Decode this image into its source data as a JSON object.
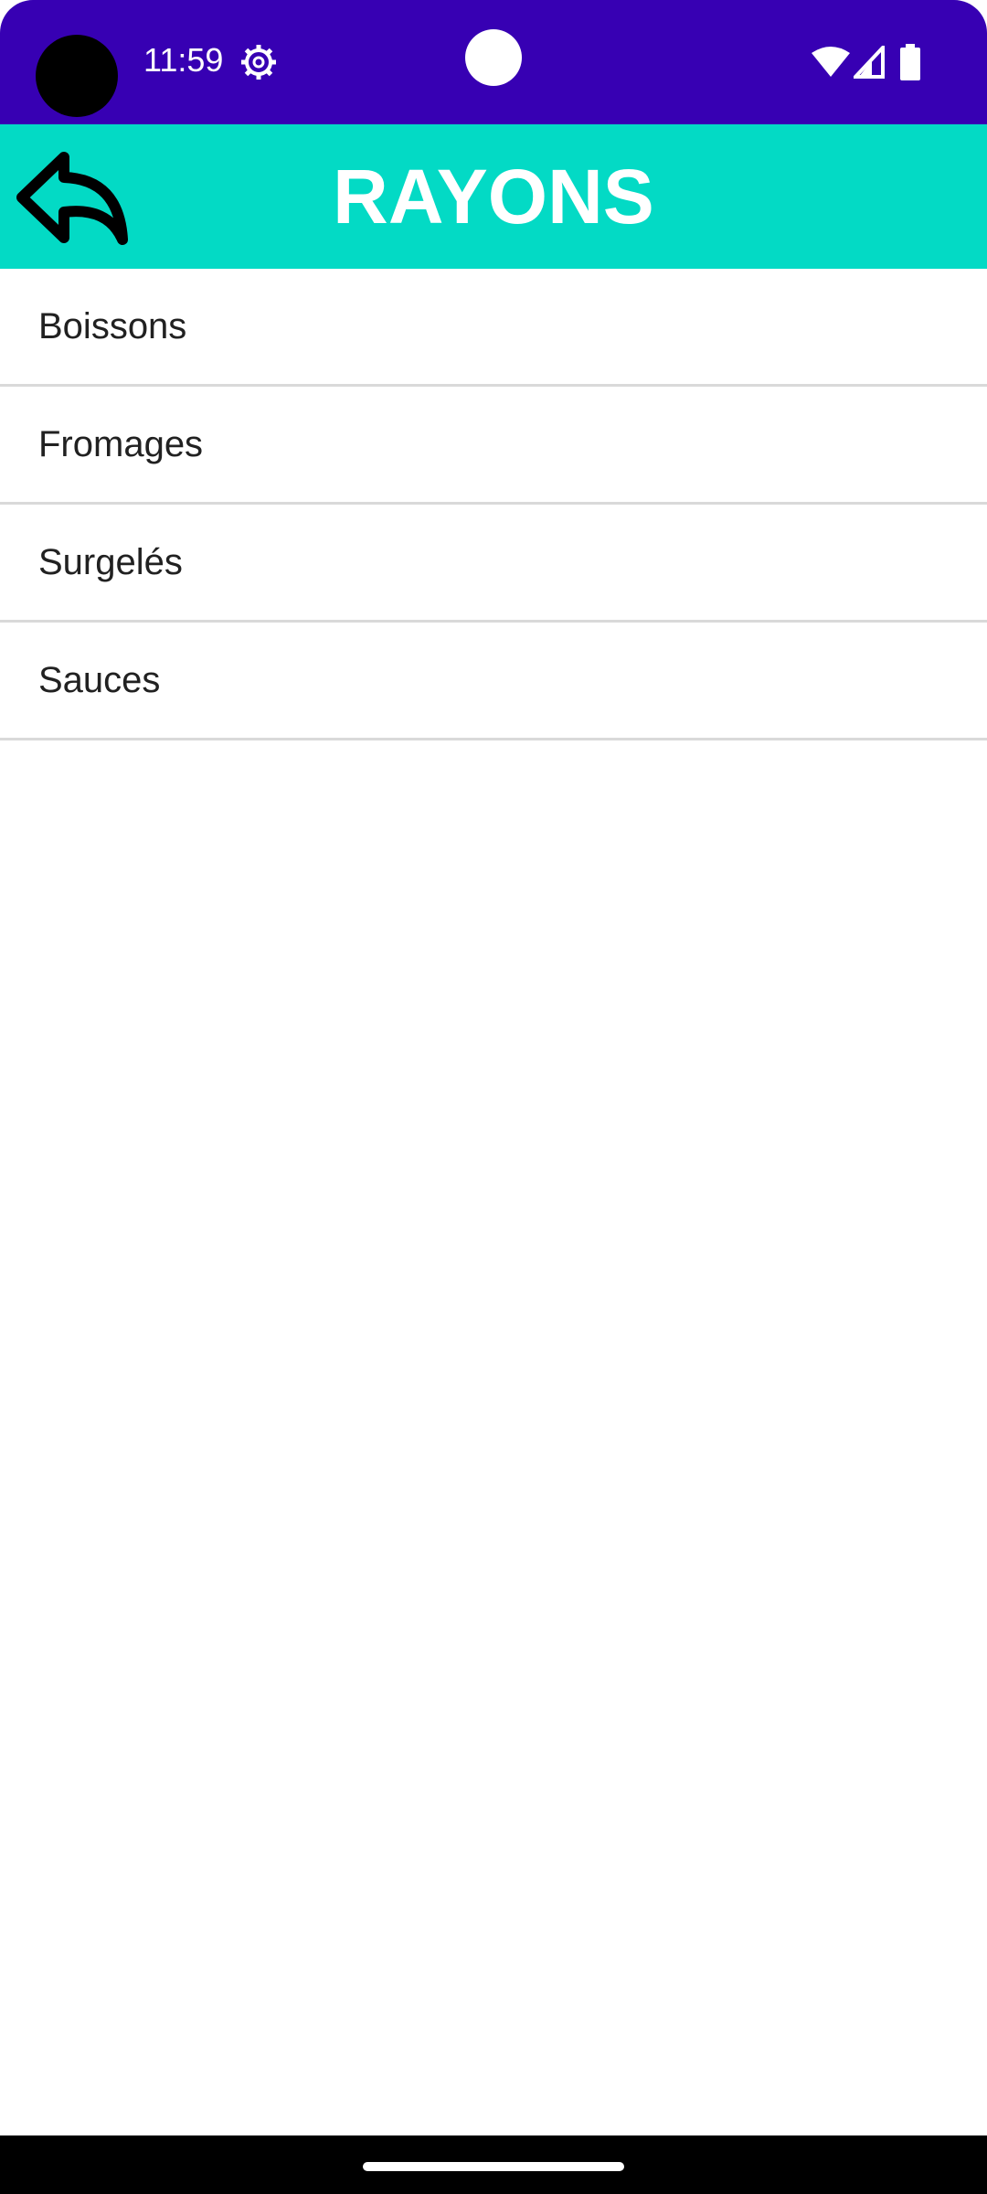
{
  "status_bar": {
    "time": "11:59",
    "icons": [
      "settings-icon",
      "wifi-icon",
      "signal-icon",
      "battery-icon"
    ],
    "background_color": "#3700b3"
  },
  "app_bar": {
    "title": "RAYONS",
    "back_icon": "back-arrow-icon",
    "background_color": "#03dac5"
  },
  "list": {
    "items": [
      {
        "label": "Boissons"
      },
      {
        "label": "Fromages"
      },
      {
        "label": "Surgelés"
      },
      {
        "label": "Sauces"
      }
    ]
  }
}
